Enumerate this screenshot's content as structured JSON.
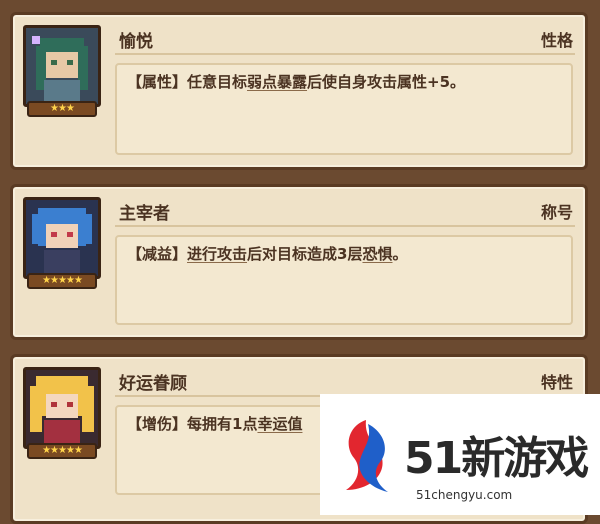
{
  "cards": [
    {
      "name": "愉悦",
      "type": "性格",
      "stars": "★★★",
      "desc": {
        "tag": "【属性】",
        "p1": "任意目标",
        "u1": "弱点暴露",
        "p2": "后使自身攻击属性+5。"
      }
    },
    {
      "name": "主宰者",
      "type": "称号",
      "stars": "★★★★★",
      "desc": {
        "tag": "【减益】",
        "u1": "进行攻击",
        "p1": "后对目标造成3层",
        "u2": "恐惧",
        "p2": "。"
      }
    },
    {
      "name": "好运眷顾",
      "type": "特性",
      "stars": "★★★★★",
      "desc": {
        "tag": "【增伤】",
        "p1": "每拥有1点",
        "u1": "幸运值",
        "p2": ""
      }
    }
  ],
  "watermark": {
    "title": "51新游戏",
    "url": "51chengyu.com"
  },
  "colors": {
    "frame": "#6b4a30",
    "card": "#efe2c8",
    "text": "#4b3322",
    "star": "#ffd34a"
  }
}
